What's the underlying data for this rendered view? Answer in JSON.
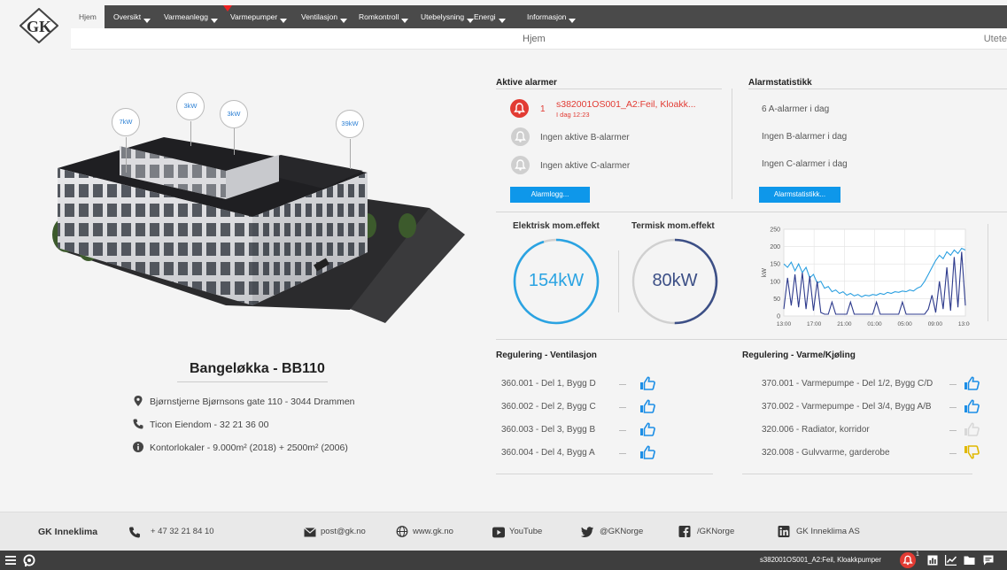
{
  "logo": {
    "text": "GK"
  },
  "nav": {
    "items": [
      {
        "label": "Hjem",
        "active": true
      },
      {
        "label": "Oversikt"
      },
      {
        "label": "Varmeanlegg"
      },
      {
        "label": "Varmepumper"
      },
      {
        "label": "Ventilasjon"
      },
      {
        "label": "Romkontroll"
      },
      {
        "label": "Utebelysning"
      },
      {
        "label": "Energi"
      },
      {
        "label": "Informasjon"
      }
    ],
    "subtitle": "Hjem",
    "subtitle_right": "Utete"
  },
  "building": {
    "bubbles": [
      "7kW",
      "3kW",
      "3kW",
      "39kW"
    ]
  },
  "site": {
    "title": "Bangeløkka - BB110",
    "address": "Bjørnstjerne Bjørnsons gate 110 - 3044 Drammen",
    "phone": "Ticon Eiendom - 32 21 36 00",
    "info": "Kontorlokaler - 9.000m² (2018) + 2500m² (2006)"
  },
  "alarms": {
    "title": "Aktive alarmer",
    "a_count": "1",
    "a_text": "s382001OS001_A2:Feil, Kloakk...",
    "a_time": "I dag 12:23",
    "b_text": "Ingen aktive B-alarmer",
    "c_text": "Ingen aktive C-alarmer",
    "button": "Alarmlogg..."
  },
  "alarm_stats": {
    "title": "Alarmstatistikk",
    "a": "6 A-alarmer i dag",
    "b": "Ingen B-alarmer i dag",
    "c": "Ingen C-alarmer i dag",
    "button": "Alarmstatistikk..."
  },
  "gauges": {
    "electric": {
      "title": "Elektrisk mom.effekt",
      "value": "154kW",
      "fraction": 0.95,
      "color": "#2aa3e2"
    },
    "thermal": {
      "title": "Termisk mom.effekt",
      "value": "80kW",
      "fraction": 0.5,
      "color": "#3c4f86"
    }
  },
  "chart_data": {
    "type": "line",
    "ylabel": "kW",
    "ylim": [
      0,
      250
    ],
    "yticks": [
      0,
      50,
      100,
      150,
      200,
      250
    ],
    "xticks": [
      "13:00",
      "17:00",
      "21:00",
      "01:00",
      "05:00",
      "09:00",
      "13:00"
    ],
    "grid": true,
    "series": [
      {
        "color": "#2a9fe0",
        "values": [
          150,
          140,
          155,
          130,
          150,
          125,
          140,
          110,
          120,
          95,
          100,
          80,
          85,
          70,
          75,
          65,
          70,
          60,
          65,
          58,
          62,
          55,
          60,
          58,
          62,
          60,
          65,
          62,
          68,
          65,
          70,
          68,
          72,
          70,
          75,
          72,
          80,
          85,
          100,
          120,
          140,
          160,
          175,
          165,
          185,
          175,
          190,
          180,
          195,
          190
        ]
      },
      {
        "color": "#2d3a8c",
        "values": [
          20,
          110,
          30,
          120,
          25,
          125,
          20,
          115,
          15,
          100,
          10,
          5,
          5,
          40,
          5,
          5,
          5,
          5,
          40,
          5,
          5,
          5,
          5,
          5,
          5,
          40,
          5,
          5,
          5,
          5,
          5,
          5,
          40,
          5,
          5,
          5,
          5,
          5,
          5,
          20,
          60,
          10,
          100,
          20,
          140,
          15,
          170,
          25,
          185,
          30
        ]
      }
    ]
  },
  "reg_vent": {
    "title": "Regulering - Ventilasjon",
    "rows": [
      {
        "label": "360.001 - Del 1, Bygg D",
        "status": "ok"
      },
      {
        "label": "360.002 - Del 2, Bygg C",
        "status": "ok"
      },
      {
        "label": "360.003 - Del 3, Bygg B",
        "status": "ok"
      },
      {
        "label": "360.004 - Del 4, Bygg A",
        "status": "ok"
      }
    ]
  },
  "reg_heat": {
    "title": "Regulering - Varme/Kjøling",
    "rows": [
      {
        "label": "370.001 - Varmepumpe - Del 1/2, Bygg C/D",
        "status": "ok"
      },
      {
        "label": "370.002 - Varmepumpe - Del 3/4, Bygg A/B",
        "status": "ok"
      },
      {
        "label": "320.006 - Radiator, korridor",
        "status": "off"
      },
      {
        "label": "320.008 - Gulvvarme, garderobe",
        "status": "bad"
      }
    ]
  },
  "footer": {
    "brand": "GK Inneklima",
    "phone": "+ 47 32 21 84 10",
    "email": "post@gk.no",
    "web": "www.gk.no",
    "youtube": "YouTube",
    "twitter": "@GKNorge",
    "facebook": "/GKNorge",
    "linkedin": "GK Inneklima AS"
  },
  "taskbar": {
    "alarm_text": "s382001OS001_A2:Feil, Kloakkpumper",
    "alarm_count": "1"
  },
  "colors": {
    "accent": "#0e97ea",
    "alarm": "#e23b33",
    "nav": "#4a4a4a"
  }
}
